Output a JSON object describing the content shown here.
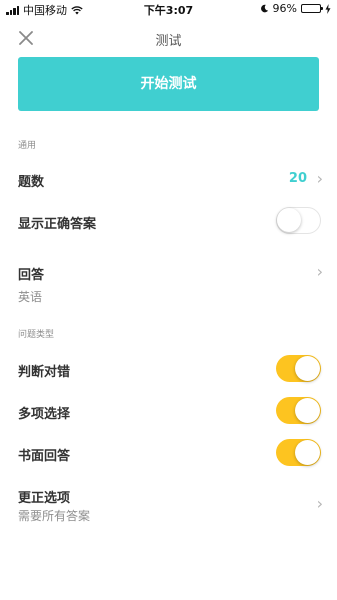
{
  "status_bar": {
    "carrier": "中国移动",
    "time": "下午3:07",
    "battery": "96%",
    "battery_level": 0.96,
    "icons": [
      "signal-icon",
      "wifi-icon",
      "moon-icon",
      "battery-icon",
      "charging-icon"
    ]
  },
  "nav": {
    "title": "测试",
    "close_icon": "close-icon"
  },
  "start_button": {
    "label": "开始测试"
  },
  "sections": {
    "general": "通用",
    "question_types": "问题类型"
  },
  "rows": {
    "question_count": {
      "label": "题数",
      "value": "20"
    },
    "show_correct_answer": {
      "label": "显示正确答案",
      "toggle": false
    },
    "answer": {
      "label": "回答",
      "value": "英语"
    },
    "true_false": {
      "label": "判断对错",
      "toggle": true
    },
    "multiple_choice": {
      "label": "多项选择",
      "toggle": true
    },
    "written": {
      "label": "书面回答",
      "toggle": true
    },
    "correction_options": {
      "label": "更正选项",
      "value": "需要所有答案"
    }
  },
  "colors": {
    "accent": "#40cfd0",
    "toggle_on": "#fdc420",
    "battery": "#4cd964"
  }
}
